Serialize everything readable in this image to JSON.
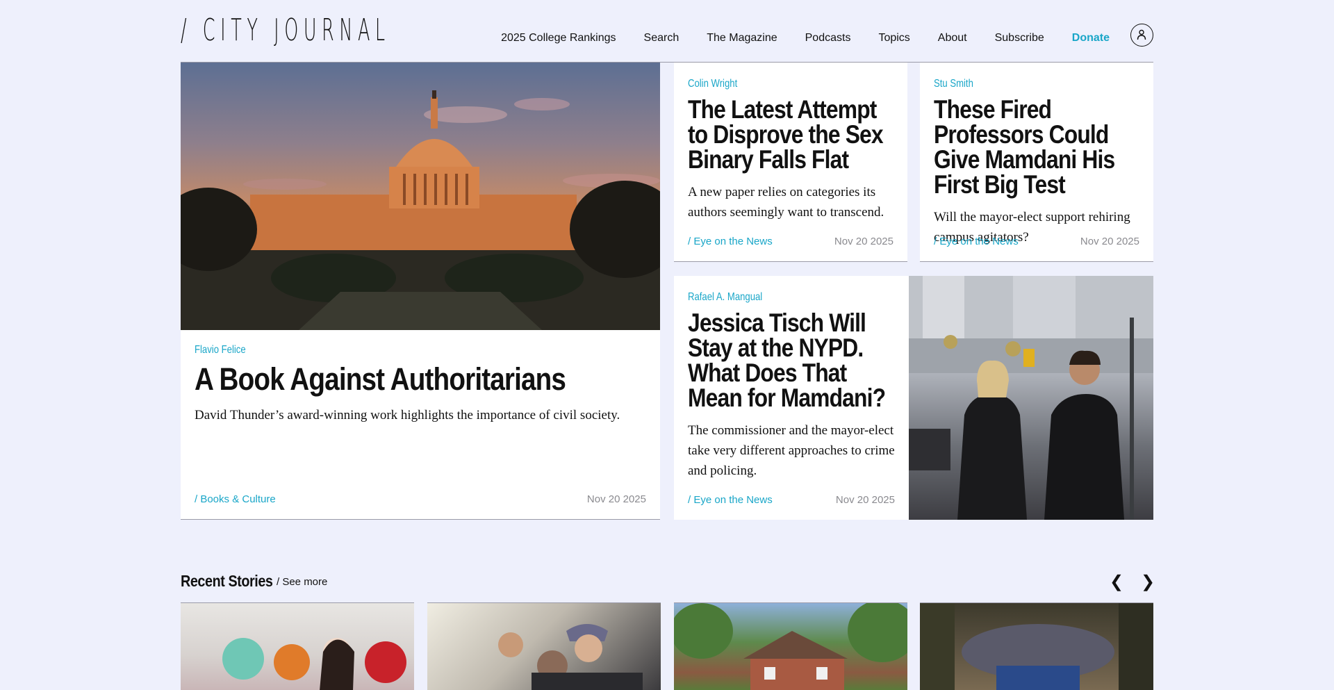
{
  "header": {
    "logo": "/ CITY JOURNAL",
    "nav": [
      {
        "label": "2025 College Rankings"
      },
      {
        "label": "Search"
      },
      {
        "label": "The Magazine"
      },
      {
        "label": "Podcasts"
      },
      {
        "label": "Topics"
      },
      {
        "label": "About"
      },
      {
        "label": "Subscribe"
      },
      {
        "label": "Donate"
      }
    ],
    "accent_color": "#19a6c8"
  },
  "featured": {
    "author": "Flavio Felice",
    "headline": "A Book Against Authoritarians",
    "dek": "David Thunder’s award-winning work highlights the importance of civil society.",
    "section": "/ Books & Culture",
    "date": "Nov 20 2025"
  },
  "story_sex_binary": {
    "author": "Colin Wright",
    "headline": "The Latest Attempt to Disprove the Sex Binary Falls Flat",
    "dek": "A new paper relies on categories its authors seemingly want to transcend.",
    "section": "/ Eye on the News",
    "date": "Nov 20 2025"
  },
  "story_professors": {
    "author": "Stu Smith",
    "headline": "These Fired Professors Could Give Mamdani His First Big Test",
    "dek": "Will the mayor-elect support rehiring campus agitators?",
    "section": "/ Eye on the News",
    "date": "Nov 20 2025"
  },
  "story_tisch": {
    "author": "Rafael A. Mangual",
    "headline": "Jessica Tisch Will Stay at the NYPD. What Does That Mean for Mamdani?",
    "dek": "The commissioner and the mayor-elect take very different approaches to crime and policing.",
    "section": "/ Eye on the News",
    "date": "Nov 20 2025"
  },
  "recent": {
    "title": "Recent Stories",
    "see_more": "/ See more",
    "prev": "❮",
    "next": "❯"
  }
}
